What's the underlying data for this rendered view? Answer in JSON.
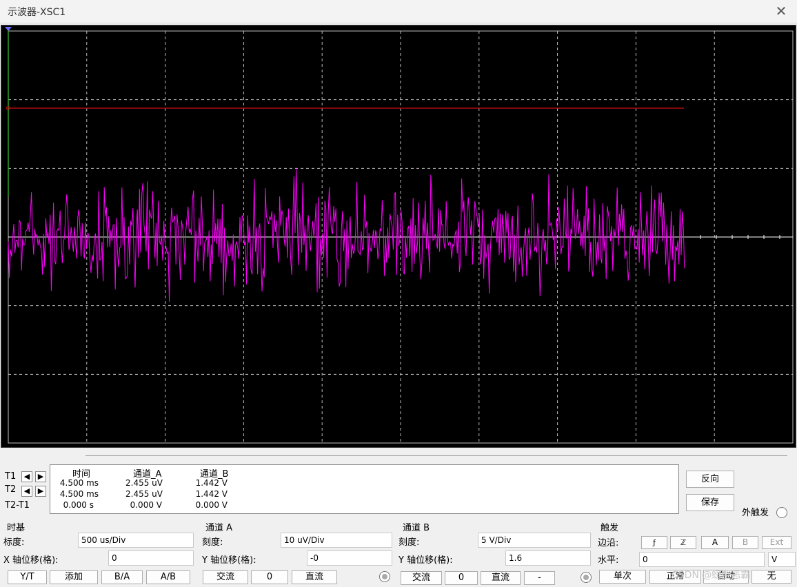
{
  "window": {
    "title": "示波器-XSC1"
  },
  "readout": {
    "headers": [
      "时间",
      "通道_A",
      "通道_B"
    ],
    "rows": [
      {
        "label": "T1",
        "time": "4.500 ms",
        "a": "2.455 uV",
        "b": "1.442 V"
      },
      {
        "label": "T2",
        "time": "4.500 ms",
        "a": "2.455 uV",
        "b": "1.442 V"
      },
      {
        "label": "T2-T1",
        "time": "0.000 s",
        "a": "0.000 V",
        "b": "0.000 V"
      }
    ]
  },
  "side_buttons": {
    "reverse": "反向",
    "save": "保存",
    "ext_trigger": "外触发"
  },
  "timebase": {
    "title": "时基",
    "scale_label": "标度:",
    "scale_value": "500 us/Div",
    "xpos_label": "X 轴位移(格):",
    "xpos_value": "0",
    "modes": [
      "Y/T",
      "添加",
      "B/A",
      "A/B"
    ]
  },
  "channel_a": {
    "title": "通道 A",
    "scale_label": "刻度:",
    "scale_value": "10 uV/Div",
    "ypos_label": "Y 轴位移(格):",
    "ypos_value": "-0",
    "coupling": [
      "交流",
      "0",
      "直流"
    ]
  },
  "channel_b": {
    "title": "通道 B",
    "scale_label": "刻度:",
    "scale_value": "5  V/Div",
    "ypos_label": "Y 轴位移(格):",
    "ypos_value": "1.6",
    "coupling": [
      "交流",
      "0",
      "直流",
      "-"
    ]
  },
  "trigger": {
    "title": "触发",
    "edge_label": "边沿:",
    "edge_buttons": [
      "ƒ",
      "ℤ",
      "A",
      "B",
      "Ext"
    ],
    "level_label": "水平:",
    "level_value": "0",
    "level_unit": "V",
    "modes": [
      "单次",
      "正常",
      "自动",
      "无"
    ]
  },
  "watermark": "CSDN @螃蟹恶霸",
  "colors": {
    "channel_a": "#ff00ff",
    "channel_b": "#d01010",
    "grid": "#bfbfbf",
    "axis": "#ffffff",
    "marker": "#2aa52a"
  }
}
